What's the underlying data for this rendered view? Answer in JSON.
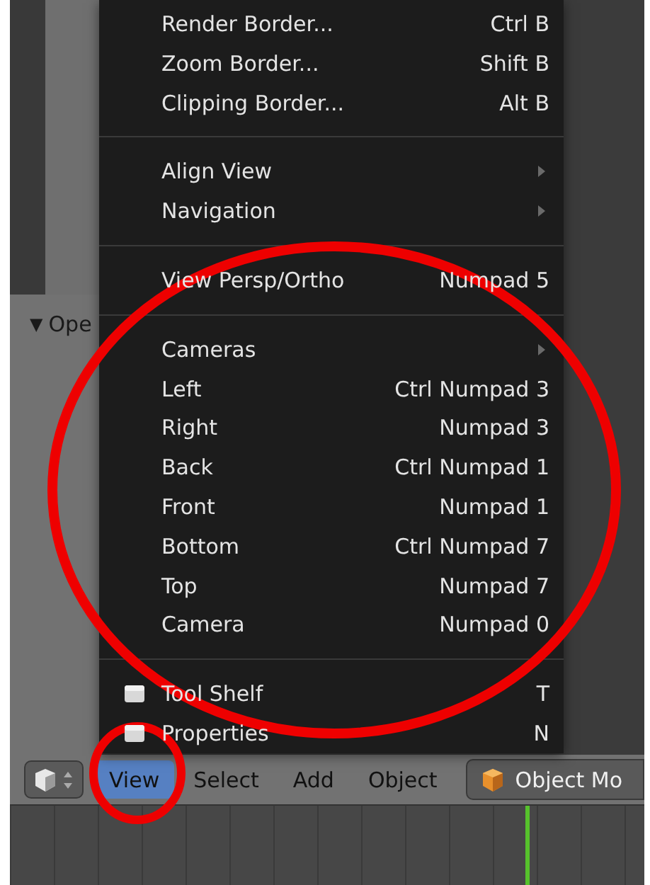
{
  "operator_panel": {
    "toggle": "▼",
    "title": "Ope"
  },
  "view_menu": {
    "items": [
      {
        "kind": "item",
        "label": "Render Border...",
        "shortcut": "Ctrl B"
      },
      {
        "kind": "item",
        "label": "Zoom Border...",
        "shortcut": "Shift B"
      },
      {
        "kind": "item",
        "label": "Clipping Border...",
        "shortcut": "Alt B"
      },
      {
        "kind": "separator"
      },
      {
        "kind": "submenu",
        "label": "Align View"
      },
      {
        "kind": "submenu",
        "label": "Navigation"
      },
      {
        "kind": "separator"
      },
      {
        "kind": "item",
        "label": "View Persp/Ortho",
        "shortcut": "Numpad 5"
      },
      {
        "kind": "separator"
      },
      {
        "kind": "submenu",
        "label": "Cameras"
      },
      {
        "kind": "item",
        "label": "Left",
        "shortcut": "Ctrl Numpad 3"
      },
      {
        "kind": "item",
        "label": "Right",
        "shortcut": "Numpad 3"
      },
      {
        "kind": "item",
        "label": "Back",
        "shortcut": "Ctrl Numpad 1"
      },
      {
        "kind": "item",
        "label": "Front",
        "shortcut": "Numpad 1"
      },
      {
        "kind": "item",
        "label": "Bottom",
        "shortcut": "Ctrl Numpad 7"
      },
      {
        "kind": "item",
        "label": "Top",
        "shortcut": "Numpad 7"
      },
      {
        "kind": "item",
        "label": "Camera",
        "shortcut": "Numpad 0"
      },
      {
        "kind": "separator"
      },
      {
        "kind": "toggle",
        "label": "Tool Shelf",
        "shortcut": "T"
      },
      {
        "kind": "toggle",
        "label": "Properties",
        "shortcut": "N"
      }
    ]
  },
  "header": {
    "menus": [
      {
        "label": "View",
        "selected": true
      },
      {
        "label": "Select",
        "selected": false
      },
      {
        "label": "Add",
        "selected": false
      },
      {
        "label": "Object",
        "selected": false
      }
    ],
    "mode": "Object Mo"
  }
}
